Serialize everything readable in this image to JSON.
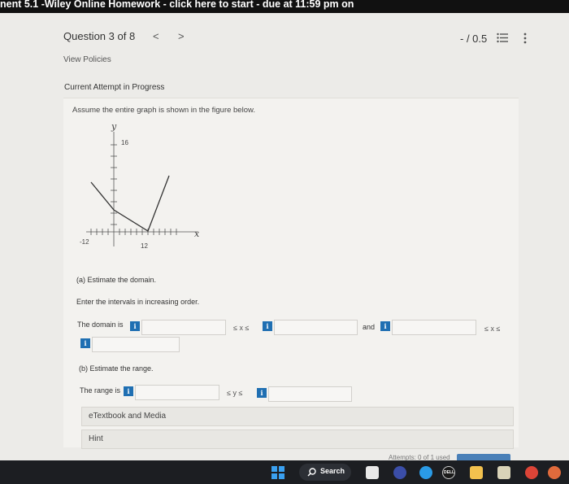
{
  "browser": {
    "tab_title": "nent 5.1 -Wiley Online Homework - click here to start - due at 11:59 pm on"
  },
  "header": {
    "question_label": "Question 3 of 8",
    "prev": "<",
    "next": ">",
    "score": "- / 0.5",
    "view_policies": "View Policies",
    "attempt_status": "Current Attempt in Progress"
  },
  "question": {
    "prompt": "Assume the entire graph is shown in the figure below.",
    "graph": {
      "y_axis_label": "y",
      "x_axis_label": "x",
      "y_tick_label": "16",
      "x_tick_left": "-12",
      "x_tick_right": "12"
    },
    "part_a": {
      "label": "(a) Estimate the domain.",
      "instruction": "Enter the intervals in increasing order.",
      "domain_label": "The domain is",
      "ineq1": "≤ x ≤",
      "and_label": "and",
      "ineq2": "≤ x ≤",
      "info": "i"
    },
    "part_b": {
      "label": "(b) Estimate the range.",
      "range_label": "The range is",
      "ineq": "≤ y ≤",
      "info": "i"
    }
  },
  "resources": {
    "etextbook": "eTextbook and Media",
    "hint": "Hint",
    "partial_footer": "Attempts: 0 of 1 used"
  },
  "taskbar": {
    "search_label": "Search",
    "dell_label": "DELL"
  }
}
